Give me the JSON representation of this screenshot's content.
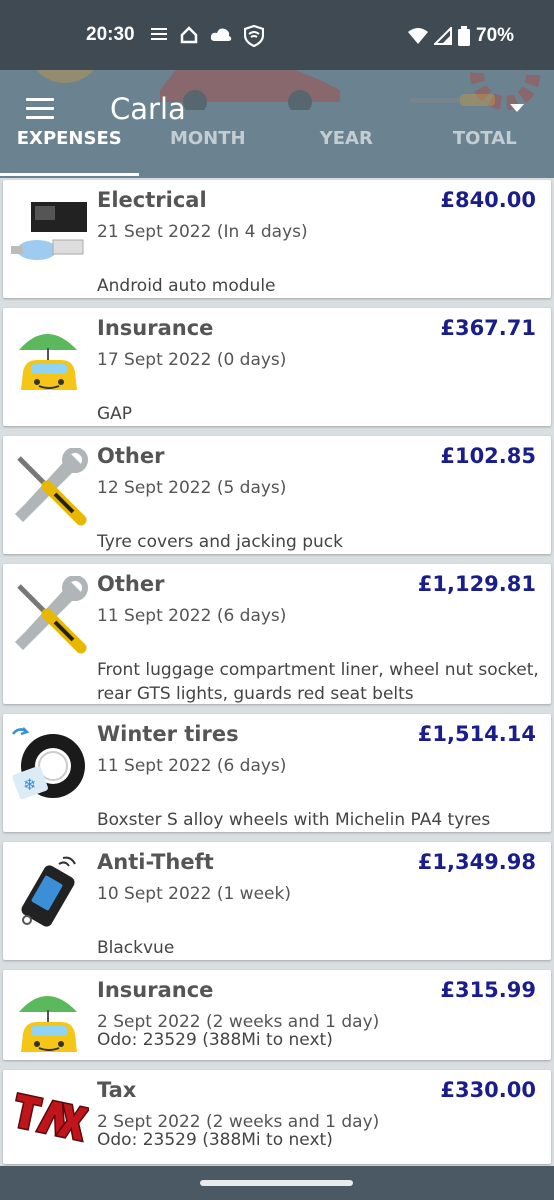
{
  "status": {
    "time": "20:30",
    "battery": "70%",
    "left_icons": [
      "signal-icon",
      "home-icon",
      "cloud-icon",
      "vpn-icon"
    ],
    "right_icons": [
      "wifi-icon",
      "cell-signal-icon",
      "battery-icon"
    ]
  },
  "toolbar": {
    "title": "Carla",
    "menu_icon": "menu-icon",
    "dropdown_icon": "dropdown-arrow-icon"
  },
  "tabs": [
    {
      "label": "EXPENSES",
      "active": true
    },
    {
      "label": "MONTH",
      "active": false
    },
    {
      "label": "YEAR",
      "active": false
    },
    {
      "label": "TOTAL",
      "active": false
    }
  ],
  "expenses": [
    {
      "category": "Electrical",
      "amount": "£840.00",
      "date": "21 Sept 2022 (In 4 days)",
      "note": "Android auto module",
      "icon": "electrical-icon"
    },
    {
      "category": "Insurance",
      "amount": "£367.71",
      "date": "17 Sept 2022 (0 days)",
      "note": "GAP",
      "icon": "insurance-icon"
    },
    {
      "category": "Other",
      "amount": "£102.85",
      "date": "12 Sept 2022 (5 days)",
      "note": "Tyre covers and jacking puck",
      "icon": "tools-icon"
    },
    {
      "category": "Other",
      "amount": "£1,129.81",
      "date": "11 Sept 2022 (6 days)",
      "note": "Front luggage compartment liner, wheel nut socket, rear GTS lights, guards red seat belts",
      "icon": "tools-icon"
    },
    {
      "category": "Winter tires",
      "amount": "£1,514.14",
      "date": "11 Sept 2022 (6 days)",
      "note": "Boxster S alloy wheels with Michelin PA4 tyres",
      "icon": "winter-tire-icon"
    },
    {
      "category": "Anti-Theft",
      "amount": "£1,349.98",
      "date": "10 Sept 2022 (1 week)",
      "note": "Blackvue",
      "icon": "car-remote-icon"
    },
    {
      "category": "Insurance",
      "amount": "£315.99",
      "date": "2 Sept 2022 (2 weeks and 1 day)",
      "note": "Odo: 23529 (388Mi to next)",
      "icon": "insurance-icon"
    },
    {
      "category": "Tax",
      "amount": "£330.00",
      "date": "2 Sept 2022 (2 weeks and 1 day)",
      "note": "Odo: 23529 (388Mi to next)",
      "icon": "tax-icon"
    }
  ],
  "colors": {
    "amount": "#1a1e8c",
    "header": "#6b8290",
    "statusbar": "#3f4a52"
  }
}
